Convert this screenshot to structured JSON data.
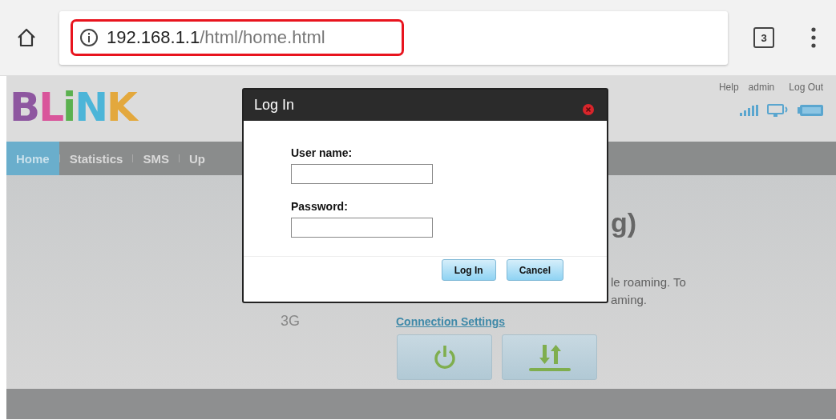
{
  "browser": {
    "url_host": "192.168.1.1",
    "url_path": "/html/home.html",
    "tab_count": "3"
  },
  "header": {
    "logo": [
      {
        "char": "B",
        "color": "#8e57a0"
      },
      {
        "char": "L",
        "color": "#d9559b"
      },
      {
        "char": "i",
        "color": "#5bb14f"
      },
      {
        "char": "N",
        "color": "#4cb5d8"
      },
      {
        "char": "K",
        "color": "#e3a83d"
      }
    ],
    "links": [
      "Help",
      "admin",
      "Log Out"
    ]
  },
  "nav": [
    {
      "label": "Home",
      "selected": true
    },
    {
      "label": "Statistics",
      "selected": false
    },
    {
      "label": "SMS",
      "selected": false
    },
    {
      "label": "Up",
      "selected": false
    }
  ],
  "content": {
    "heading": "g)",
    "lines": [
      "le roaming. To",
      "aming."
    ],
    "network": "3G",
    "link": "Connection Settings",
    "actions": [
      {
        "kind": "power"
      },
      {
        "kind": "transfer"
      }
    ]
  },
  "dialog": {
    "title": "Log In",
    "fields": [
      {
        "label": "User name:"
      },
      {
        "label": "Password:"
      }
    ],
    "buttons": [
      "Log In",
      "Cancel"
    ]
  }
}
